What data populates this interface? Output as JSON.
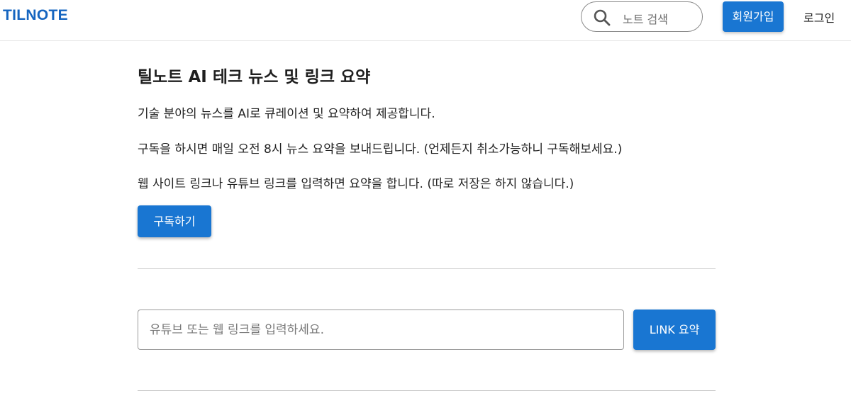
{
  "header": {
    "logo": "TILNOTE",
    "search": {
      "placeholder": "노트 검색",
      "icon": "search-icon"
    },
    "signup_label": "회원가입",
    "login_label": "로그인"
  },
  "main": {
    "title": "틸노트 AI 테크 뉴스 및 링크 요약",
    "paragraphs": [
      "기술 분야의 뉴스를 AI로 큐레이션 및 요약하여 제공합니다.",
      "구독을 하시면 매일 오전 8시 뉴스 요약을 보내드립니다. (언제든지 취소가능하니 구독해보세요.)",
      "웹 사이트 링크나 유튜브 링크를 입력하면 요약을 합니다. (따로 저장은 하지 않습니다.)"
    ],
    "subscribe_label": "구독하기",
    "link_input": {
      "placeholder": "유튜브 또는 웹 링크를 입력하세요.",
      "value": ""
    },
    "link_button_label": "LINK 요약"
  },
  "colors": {
    "accent": "#1976d2",
    "logo": "#1565c0",
    "divider": "#c9c9c9"
  }
}
